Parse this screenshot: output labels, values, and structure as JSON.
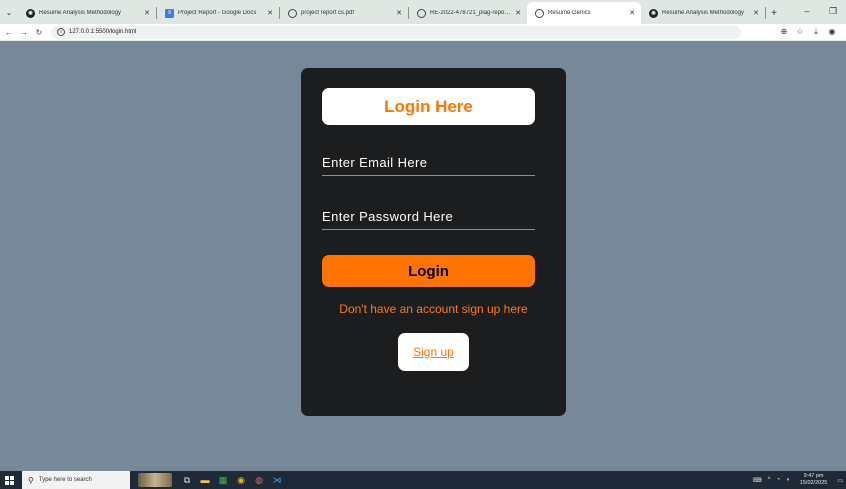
{
  "browser": {
    "tabs": [
      {
        "label": "Resume Analysis Methodology",
        "icon": "chatgpt-icon",
        "active": false
      },
      {
        "label": "Project Report - Google Docs",
        "icon": "docs-icon",
        "active": false
      },
      {
        "label": "project report cs.pdf",
        "icon": "globe-icon",
        "active": false
      },
      {
        "label": "RE-2022-478721_plag-report.p",
        "icon": "globe-icon",
        "active": false
      },
      {
        "label": "Resume Genics",
        "icon": "globe-icon",
        "active": true
      },
      {
        "label": "Resume Analysis Methodology",
        "icon": "chatgpt-icon",
        "active": false
      }
    ],
    "url": "127.0.0.1:5500/login.html"
  },
  "login": {
    "title": "Login Here",
    "email_placeholder": "Enter Email Here",
    "password_placeholder": "Enter Password Here",
    "login_button": "Login",
    "signup_prompt": "Don't have an account sign up here",
    "signup_link": "Sign up"
  },
  "taskbar": {
    "search_placeholder": "Type here to search",
    "time": "9:47 pm",
    "date": "15/02/2025"
  },
  "colors": {
    "accent": "#ff7300",
    "page_bg": "#778899",
    "card_bg": "#1c1d1f"
  }
}
